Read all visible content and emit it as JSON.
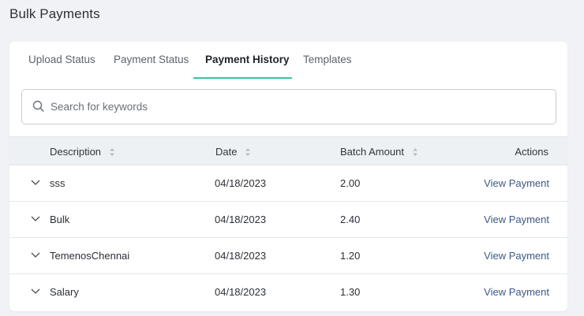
{
  "page": {
    "title": "Bulk Payments"
  },
  "tabs": [
    {
      "label": "Upload Status",
      "active": false
    },
    {
      "label": "Payment Status",
      "active": false
    },
    {
      "label": "Payment History",
      "active": true
    },
    {
      "label": "Templates",
      "active": false
    }
  ],
  "search": {
    "placeholder": "Search for keywords",
    "value": "",
    "icon": "search-icon"
  },
  "table": {
    "columns": {
      "description": "Description",
      "date": "Date",
      "batch_amount": "Batch Amount",
      "actions": "Actions"
    },
    "rows": [
      {
        "description": "sss",
        "date": "04/18/2023",
        "amount": "2.00",
        "action": "View Payment"
      },
      {
        "description": "Bulk",
        "date": "04/18/2023",
        "amount": "2.40",
        "action": "View Payment"
      },
      {
        "description": "TemenosChennai",
        "date": "04/18/2023",
        "amount": "1.20",
        "action": "View Payment"
      },
      {
        "description": "Salary",
        "date": "04/18/2023",
        "amount": "1.30",
        "action": "View Payment"
      }
    ]
  },
  "colors": {
    "accent": "#35c5a0",
    "link": "#3a5a85",
    "header_bg": "#eef1f4",
    "page_bg": "#f1f2f5"
  }
}
